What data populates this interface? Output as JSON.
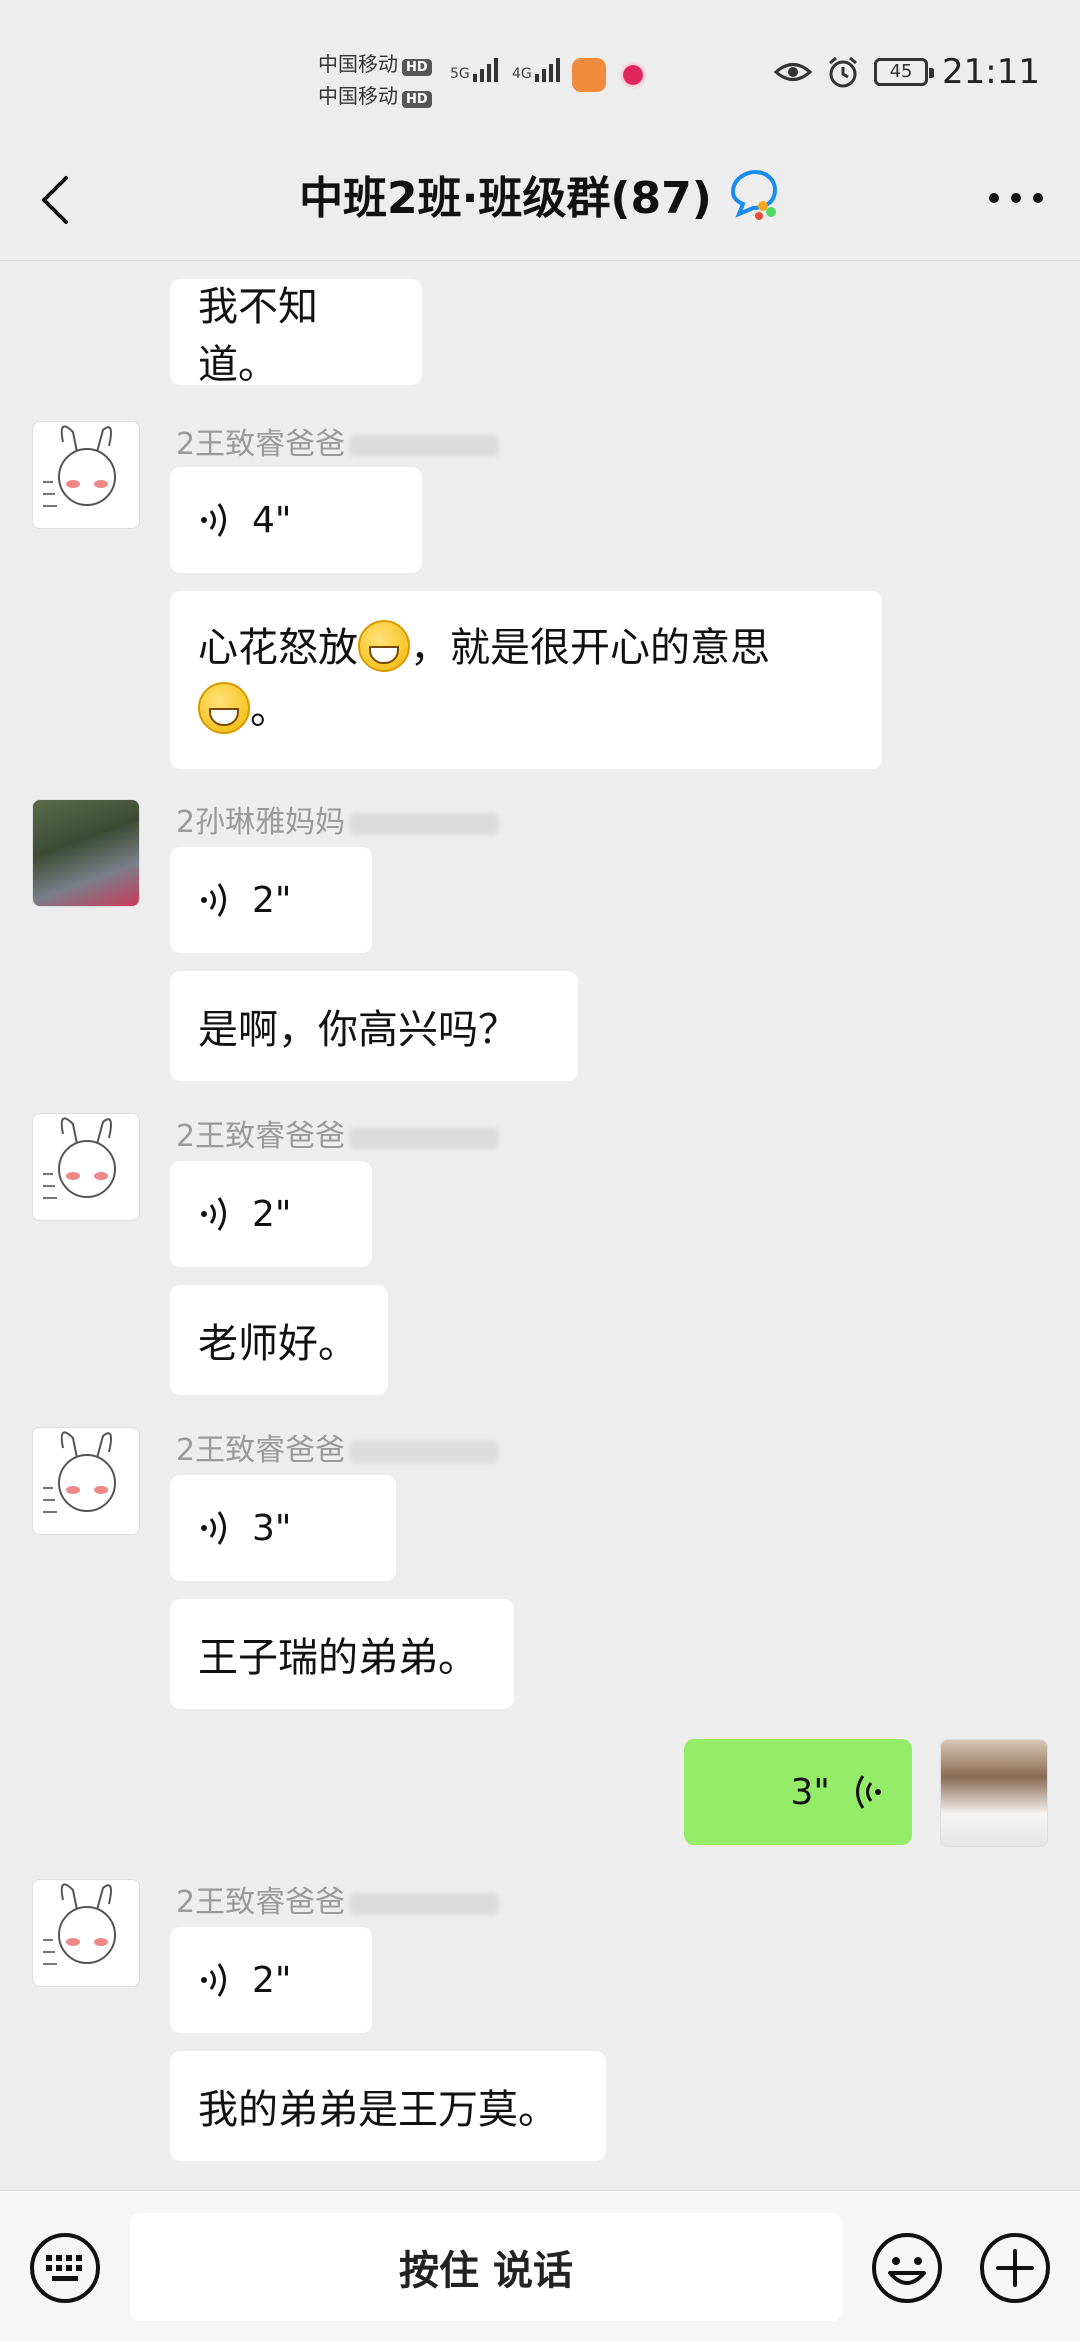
{
  "status_bar": {
    "carrier_1": "中国移动",
    "carrier_2": "中国移动",
    "hd": "HD",
    "net_1": "5G",
    "net_2": "4G",
    "battery": "45",
    "time": "21:11"
  },
  "header": {
    "title": "中班2班·班级群(87)"
  },
  "messages": {
    "m1_text": "我不知道。",
    "m2_sender": "2王致睿爸爸",
    "m2_voice": "4\"",
    "m3_text_a": "心花怒放",
    "m3_text_b": "，就是很开心的意思",
    "m3_text_c": "。",
    "m4_sender": "2孙琳雅妈妈",
    "m4_voice": "2\"",
    "m5_text": "是啊，你高兴吗？",
    "m6_sender": "2王致睿爸爸",
    "m6_voice": "2\"",
    "m7_text": "老师好。",
    "m8_sender": "2王致睿爸爸",
    "m8_voice": "3\"",
    "m9_text": "王子瑞的弟弟。",
    "m10_voice": "3\"",
    "m11_sender": "2王致睿爸爸",
    "m11_voice": "2\"",
    "m12_text": "我的弟弟是王万莫。"
  },
  "input_bar": {
    "hold_to_talk": "按住 说话"
  },
  "colors": {
    "background": "#ededed",
    "bubble_self": "#95ec69",
    "bubble_other": "#ffffff"
  }
}
